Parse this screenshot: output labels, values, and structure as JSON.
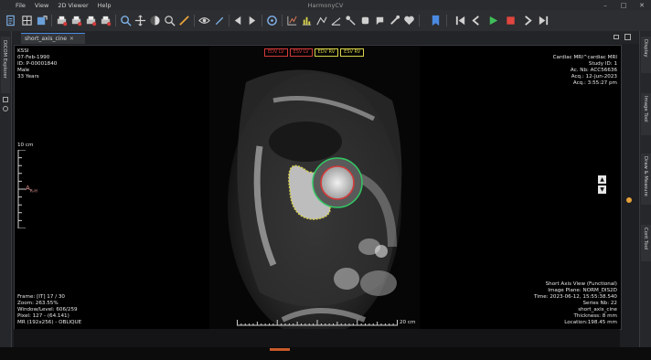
{
  "app": {
    "title": "HarmonyCV"
  },
  "menu": [
    "File",
    "View",
    "2D Viewer",
    "Help"
  ],
  "toolbar": {
    "icons": [
      "dicom-browser-icon",
      "layout-icon",
      "export-icon",
      "print-icon",
      "save-series-icon",
      "save-image-icon",
      "send-icon",
      "zoom-icon",
      "pan-icon",
      "window-level-icon",
      "magnifier-icon",
      "measure-icon",
      "ruler-icon",
      "angle-icon",
      "cobb-angle-icon",
      "roi-icon",
      "eye-icon",
      "annotation-icon",
      "pen-icon",
      "previous-series-icon",
      "next-series-icon",
      "sync-icon",
      "reset-icon",
      "histogram-icon",
      "contour-icon",
      "heart-icon",
      "first-frame-icon",
      "previous-frame-icon",
      "play-icon",
      "stop-icon",
      "next-frame-icon",
      "last-frame-icon",
      "bookmark-icon"
    ]
  },
  "left_dock": {
    "tab_label": "DICOM Explorer"
  },
  "right_dock": {
    "tabs": [
      "Display",
      "Image Tool",
      "Draw & Measure",
      "Cont Tool"
    ]
  },
  "viewer_tab": {
    "label": "short_axis_cine"
  },
  "contour_legend": [
    {
      "label": "EDV LV",
      "color": "#d23a3a"
    },
    {
      "label": "ESV LV",
      "color": "#d23a3a"
    },
    {
      "label": "EDV RV",
      "color": "#d8d24a"
    },
    {
      "label": "ESV RV",
      "color": "#d8d24a"
    }
  ],
  "overlay": {
    "top_left": [
      "KSSI",
      "07-Feb-1990",
      "ID: P-00001840",
      "Male",
      "33 Years"
    ],
    "top_right": [
      "Cardiac MRI^cardiac MRI",
      "Study ID: 1",
      "Ac. Nb: ACC56636",
      "Acq.: 12-Jun-2023",
      "Acq.: 3:55:27 pm"
    ],
    "bottom_left": [
      "Frame: [IT] 17 / 30",
      "Zoom: 263.55%",
      "Window/Level: 606/259",
      "Pixel: 127 - (64.141)",
      "MR (192x256) - OBLIQUE"
    ],
    "bottom_right": [
      "Short Axis View (Functional)",
      "Image Plane: NORM_DIS2D",
      "Time: 2023-06-12, 15:55:38.540",
      "Series Nb: 22",
      "short_axis_cine",
      "Thickness: 8 mm",
      "Location:198.45 mm"
    ]
  },
  "scale": {
    "vertical_label": "10 cm",
    "horizontal_label": "20 cm"
  },
  "orientation": {
    "main": "A",
    "sub": "R-H"
  },
  "colors": {
    "lv_endo": "#d23a3a",
    "lv_epi": "#32c864",
    "rv": "#d8d24a",
    "accent": "#4a8ae0"
  }
}
